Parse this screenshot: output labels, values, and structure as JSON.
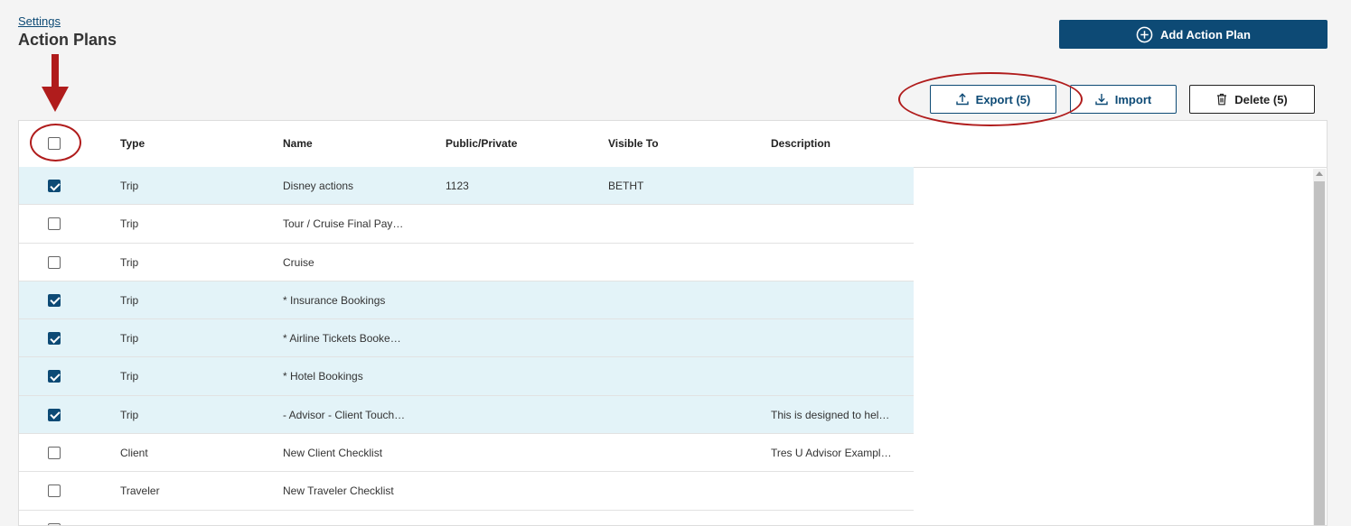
{
  "breadcrumb": "Settings",
  "page_title": "Action Plans",
  "buttons": {
    "add": "Add Action Plan",
    "export": "Export (5)",
    "import": "Import",
    "delete": "Delete (5)"
  },
  "columns": [
    "Type",
    "Name",
    "Public/Private",
    "Visible To",
    "Description"
  ],
  "rows": [
    {
      "type": "Trip",
      "name": "Disney actions",
      "public_private": "1123",
      "visible_to": "BETHT",
      "description": "",
      "checked": true
    },
    {
      "type": "Trip",
      "name": "Tour / Cruise Final Pay…",
      "public_private": "",
      "visible_to": "",
      "description": "",
      "checked": false
    },
    {
      "type": "Trip",
      "name": "Cruise",
      "public_private": "",
      "visible_to": "",
      "description": "",
      "checked": false
    },
    {
      "type": "Trip",
      "name": "* Insurance Bookings",
      "public_private": "",
      "visible_to": "",
      "description": "",
      "checked": true
    },
    {
      "type": "Trip",
      "name": "* Airline Tickets Booke…",
      "public_private": "",
      "visible_to": "",
      "description": "",
      "checked": true
    },
    {
      "type": "Trip",
      "name": "* Hotel Bookings",
      "public_private": "",
      "visible_to": "",
      "description": "",
      "checked": true
    },
    {
      "type": "Trip",
      "name": "- Advisor - Client Touch…",
      "public_private": "",
      "visible_to": "",
      "description": "This is designed to hel…",
      "checked": true
    },
    {
      "type": "Client",
      "name": "New Client Checklist",
      "public_private": "",
      "visible_to": "",
      "description": "Tres U Advisor Exampl…",
      "checked": false
    },
    {
      "type": "Traveler",
      "name": "New Traveler Checklist",
      "public_private": "",
      "visible_to": "",
      "description": "",
      "checked": false
    },
    {
      "type": "",
      "name": "",
      "public_private": "",
      "visible_to": "",
      "description": "",
      "checked": false
    }
  ],
  "colors": {
    "primary": "#0d4a75",
    "selected_row": "#e3f3f8",
    "annotation": "#b01c1c"
  }
}
